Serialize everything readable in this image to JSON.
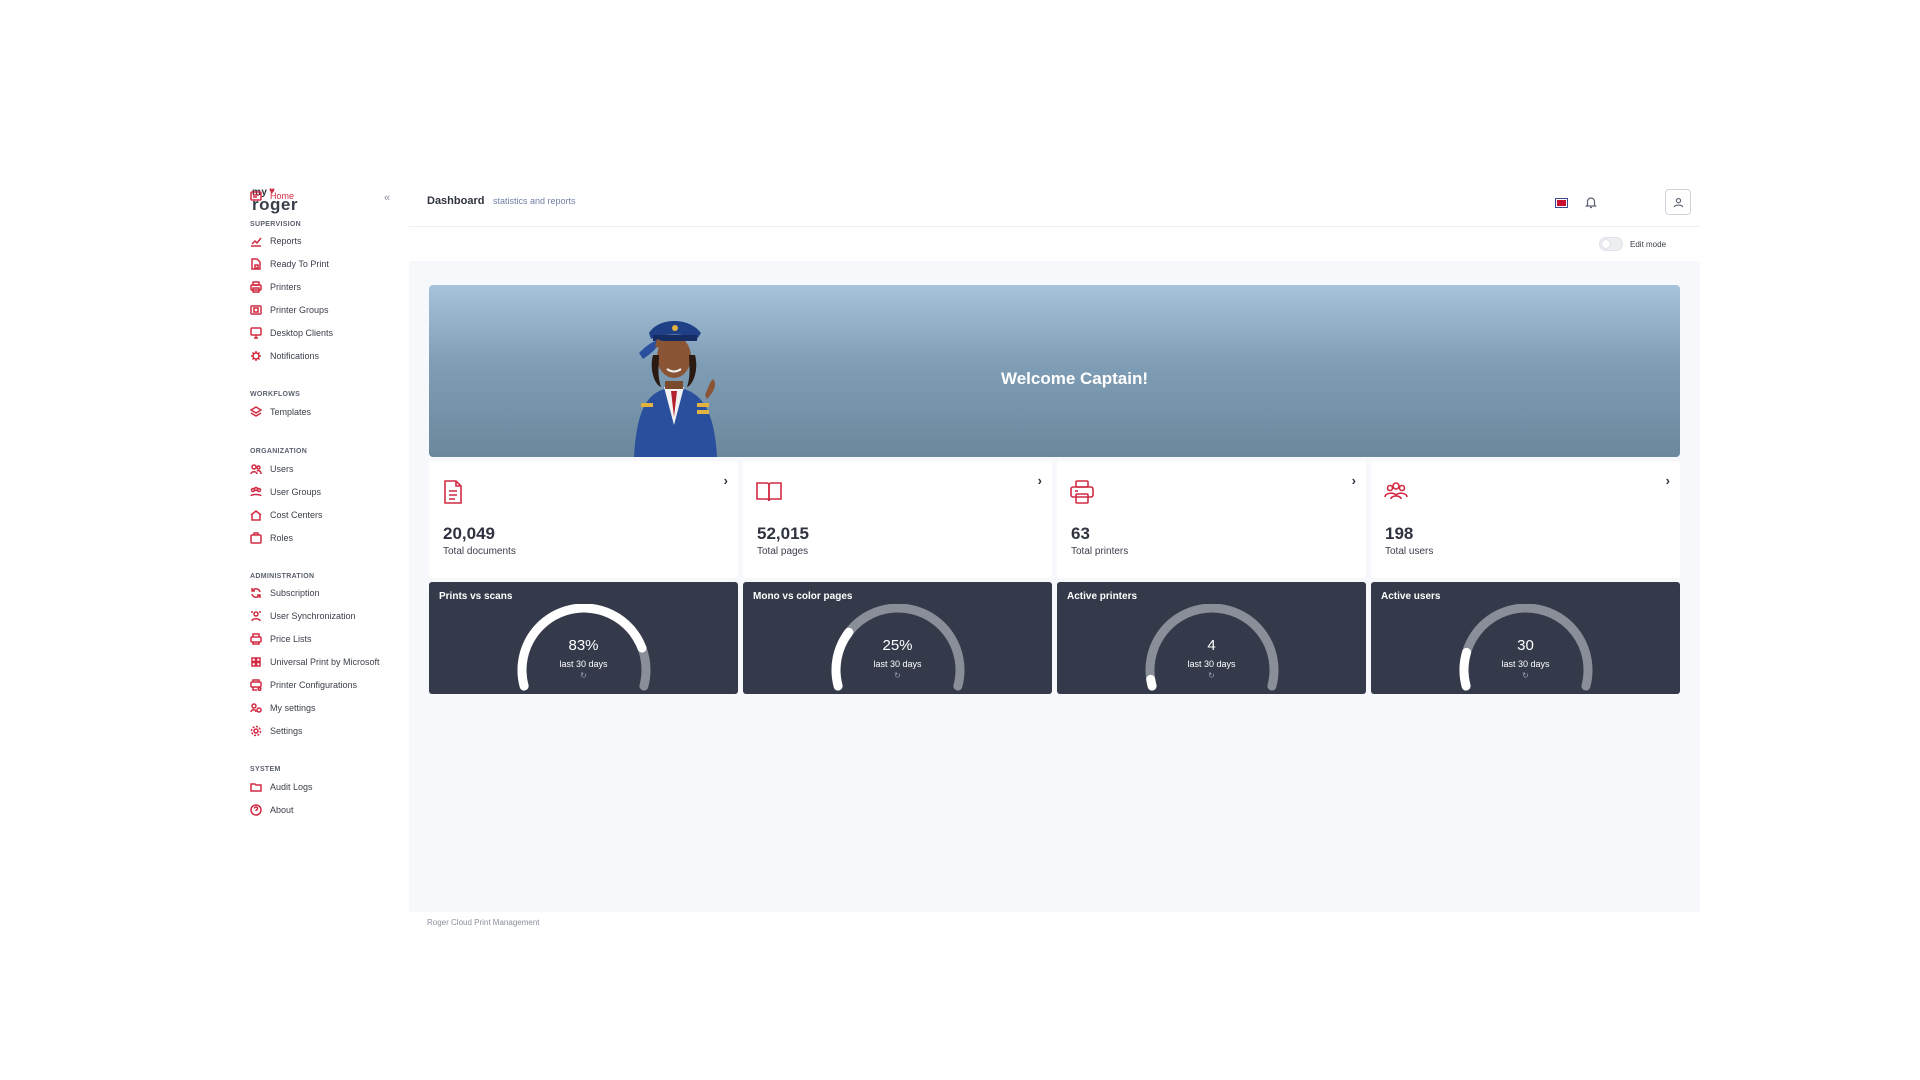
{
  "brand": {
    "my": "my",
    "name": "roger"
  },
  "sidebar": {
    "home": "Home",
    "sections": [
      {
        "title": "SUPERVISION",
        "items": [
          "Reports",
          "Ready To Print",
          "Printers",
          "Printer Groups",
          "Desktop Clients",
          "Notifications"
        ]
      },
      {
        "title": "WORKFLOWS",
        "items": [
          "Templates"
        ]
      },
      {
        "title": "ORGANIZATION",
        "items": [
          "Users",
          "User Groups",
          "Cost Centers",
          "Roles"
        ]
      },
      {
        "title": "ADMINISTRATION",
        "items": [
          "Subscription",
          "User Synchronization",
          "Price Lists",
          "Universal Print by Microsoft",
          "Printer Configurations",
          "My settings",
          "Settings"
        ]
      },
      {
        "title": "SYSTEM",
        "items": [
          "Audit Logs",
          "About"
        ]
      }
    ]
  },
  "header": {
    "title": "Dashboard",
    "subtitle": "statistics and reports"
  },
  "edit_mode": {
    "label": "Edit mode",
    "enabled": false
  },
  "banner": {
    "text": "Welcome Captain!"
  },
  "stats": [
    {
      "value": "20,049",
      "label": "Total documents",
      "icon": "document-icon"
    },
    {
      "value": "52,015",
      "label": "Total pages",
      "icon": "book-icon"
    },
    {
      "value": "63",
      "label": "Total printers",
      "icon": "printer-icon"
    },
    {
      "value": "198",
      "label": "Total users",
      "icon": "users-icon"
    }
  ],
  "gauges": [
    {
      "title": "Prints vs scans",
      "value": "83%",
      "fraction": 0.83,
      "sub": "last 30 days"
    },
    {
      "title": "Mono vs color pages",
      "value": "25%",
      "fraction": 0.25,
      "sub": "last 30 days"
    },
    {
      "title": "Active printers",
      "value": "4",
      "fraction": 0.03,
      "sub": "last 30 days"
    },
    {
      "title": "Active users",
      "value": "30",
      "fraction": 0.15,
      "sub": "last 30 days"
    }
  ],
  "footer": {
    "text": "Roger Cloud Print Management"
  },
  "colors": {
    "accent": "#d12b43",
    "gauge_bg": "#343a4a",
    "gauge_fill": "#ffffff",
    "gauge_track": "#8a8e98"
  }
}
